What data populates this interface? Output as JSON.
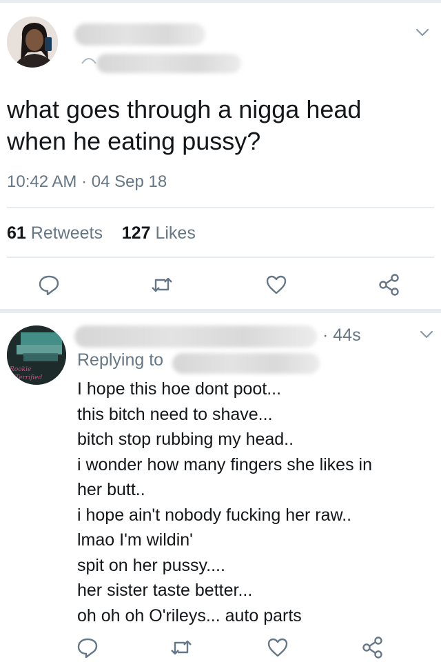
{
  "tweet": {
    "text": "what goes through a nigga head when he eating pussy?",
    "timestamp": "10:42 AM · 04 Sep 18",
    "retweets_count": "61",
    "retweets_label": "Retweets",
    "likes_count": "127",
    "likes_label": "Likes"
  },
  "reply": {
    "time": "· 44s",
    "replying_to": "Replying to",
    "lines": [
      "I hope this hoe dont poot...",
      "this bitch need to shave...",
      "bitch stop rubbing my head..",
      "i wonder how many fingers she likes in",
      "her butt..",
      "i hope ain't nobody fucking her raw..",
      "lmao I'm wildin'",
      "spit on her pussy....",
      "her sister taste better...",
      "oh oh oh O'rileys... auto parts"
    ],
    "avatar_text": "Rookie Terrified"
  },
  "icons": [
    "chevron-down-icon",
    "reply-icon",
    "retweet-icon",
    "like-icon",
    "share-icon"
  ],
  "colors": {
    "text": "#14171a",
    "secondary": "#657786",
    "divider": "#e6ecf0"
  }
}
